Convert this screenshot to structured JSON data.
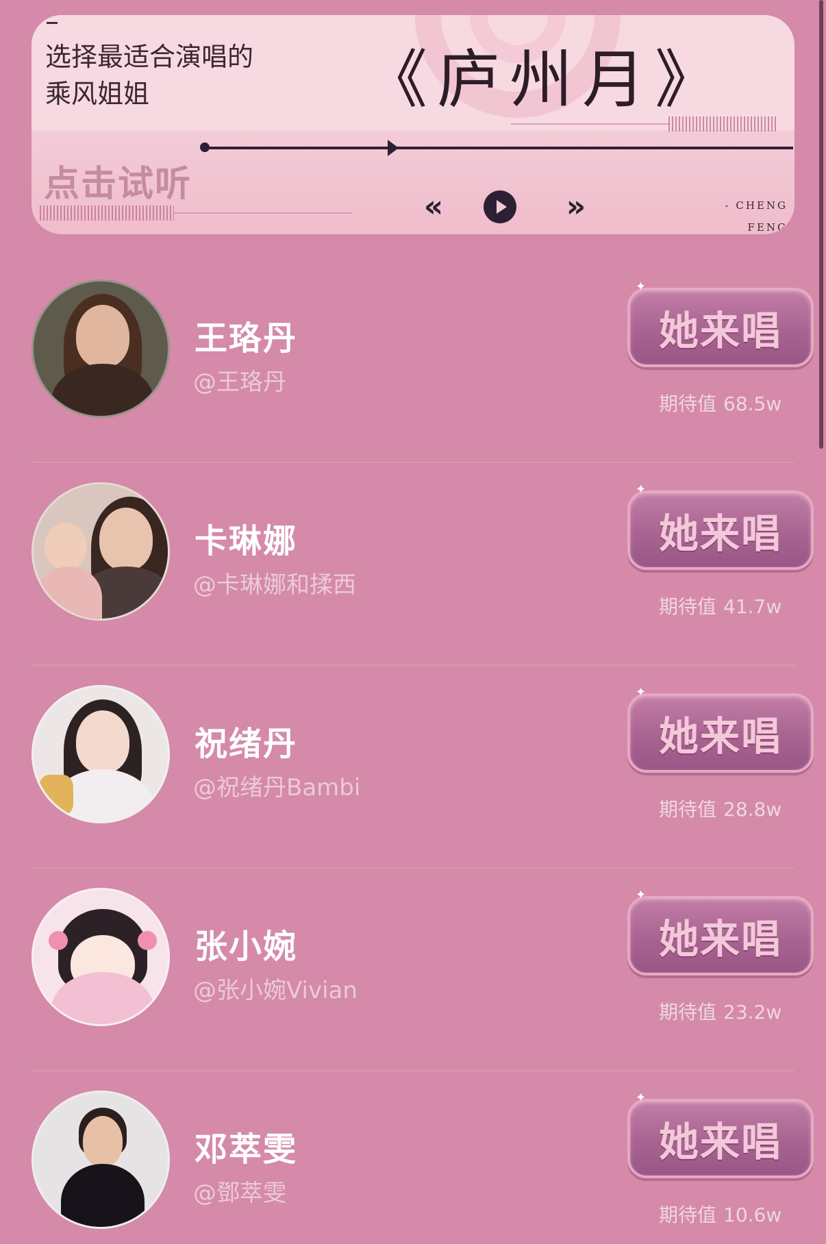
{
  "header": {
    "subtitle_line1": "选择最适合演唱的",
    "subtitle_line2": "乘风姐姐",
    "song_title": "《庐州月》",
    "listen_label": "点击试听",
    "brand_line1": "- CHENG",
    "brand_line2": "FENG",
    "controls": {
      "prev_icon": "«",
      "next_icon": "»"
    }
  },
  "list": {
    "items": [
      {
        "name": "王珞丹",
        "handle": "@王珞丹",
        "button_label": "她来唱",
        "expect_label": "期待值",
        "expect_value": "68.5w"
      },
      {
        "name": "卡琳娜",
        "handle": "@卡琳娜和揉西",
        "button_label": "她来唱",
        "expect_label": "期待值",
        "expect_value": "41.7w"
      },
      {
        "name": "祝绪丹",
        "handle": "@祝绪丹Bambi",
        "button_label": "她来唱",
        "expect_label": "期待值",
        "expect_value": "28.8w"
      },
      {
        "name": "张小婉",
        "handle": "@张小婉Vivian",
        "button_label": "她来唱",
        "expect_label": "期待值",
        "expect_value": "23.2w"
      },
      {
        "name": "邓萃雯",
        "handle": "@鄧萃雯",
        "button_label": "她来唱",
        "expect_label": "期待值",
        "expect_value": "10.6w"
      }
    ]
  },
  "colors": {
    "background": "#d48aa8",
    "card": "#f6d6df",
    "button": "#a86391",
    "dark": "#2d2035"
  }
}
